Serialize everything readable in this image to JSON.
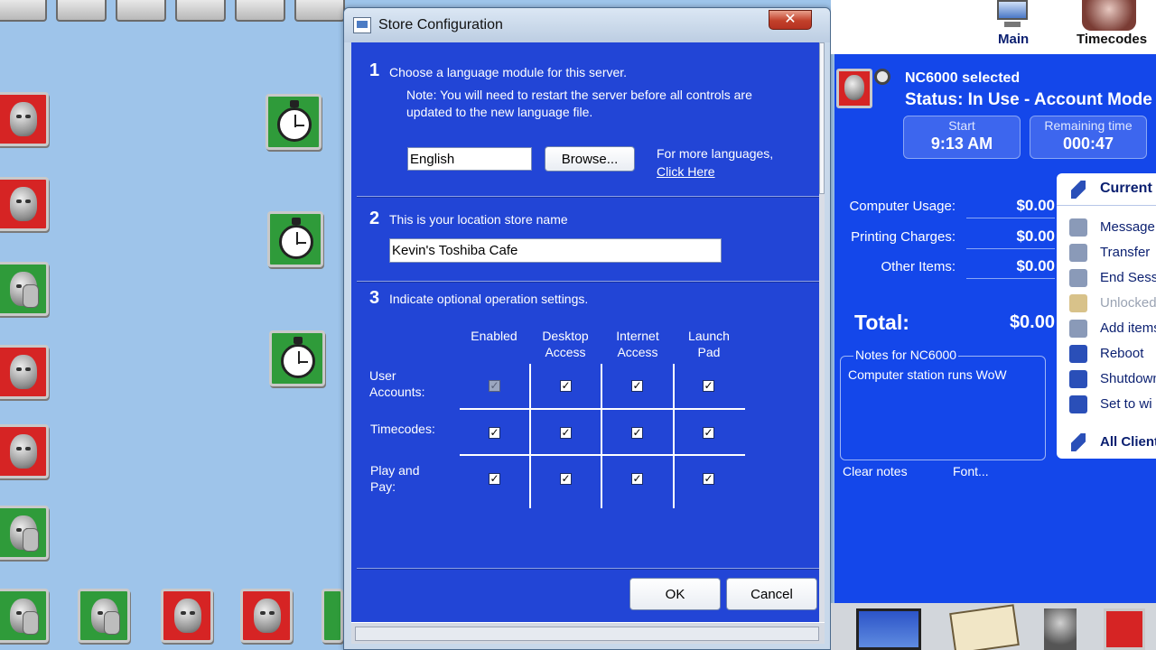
{
  "dialog": {
    "title": "Store Configuration",
    "close_glyph": "✕",
    "section1": {
      "number": "1",
      "heading": "Choose a language module for this server.",
      "note": "Note: You will need to restart the server before all controls are updated to the new language file.",
      "language_value": "English",
      "browse_label": "Browse...",
      "more_languages": "For more languages,",
      "click_here": "Click Here"
    },
    "section2": {
      "number": "2",
      "heading": "This is your location store name",
      "store_name": "Kevin's Toshiba Cafe"
    },
    "section3": {
      "number": "3",
      "heading": "Indicate optional operation settings.",
      "columns": [
        "Enabled",
        "Desktop\nAccess",
        "Internet\nAccess",
        "Launch\nPad"
      ],
      "rows": [
        {
          "label": "User\nAccounts:",
          "checks": [
            true,
            true,
            true,
            true
          ],
          "disabled": [
            true,
            false,
            false,
            false
          ]
        },
        {
          "label": "Timecodes:",
          "checks": [
            true,
            true,
            true,
            true
          ],
          "disabled": [
            false,
            false,
            false,
            false
          ]
        },
        {
          "label": "Play and\nPay:",
          "checks": [
            true,
            true,
            true,
            true
          ],
          "disabled": [
            false,
            false,
            false,
            false
          ]
        }
      ]
    },
    "ok_label": "OK",
    "cancel_label": "Cancel"
  },
  "nav": {
    "main_label": "Main",
    "timecodes_label": "Timecodes"
  },
  "station": {
    "selected": "NC6000 selected",
    "status": "Status: In Use - Account Mode",
    "start_label": "Start",
    "start_value": "9:13 AM",
    "remaining_label": "Remaining time",
    "remaining_value": "000:47",
    "charges": [
      {
        "label": "Computer Usage:",
        "value": "$0.00"
      },
      {
        "label": "Printing Charges:",
        "value": "$0.00"
      },
      {
        "label": "Other Items:",
        "value": "$0.00"
      }
    ],
    "total_label": "Total:",
    "total_value": "$0.00",
    "notes_title": "Notes for NC6000",
    "notes_text": "Computer station runs WoW",
    "clear_notes": "Clear notes",
    "font": "Font..."
  },
  "actions": {
    "header": "Current",
    "items": [
      {
        "label": "Message",
        "enabled": true
      },
      {
        "label": "Transfer",
        "enabled": true
      },
      {
        "label": "End Session",
        "enabled": true
      },
      {
        "label": "Unlocked",
        "enabled": false
      },
      {
        "label": "Add items",
        "enabled": true
      },
      {
        "label": "Reboot",
        "enabled": true
      },
      {
        "label": "Shutdown",
        "enabled": true
      },
      {
        "label": "Set to wi",
        "enabled": true
      }
    ],
    "all_clients": "All Clients"
  },
  "colors": {
    "dialog_blue": "#2245d6",
    "panel_blue": "#1447ea",
    "station_red": "#d62424",
    "station_green": "#2f9b3a"
  }
}
